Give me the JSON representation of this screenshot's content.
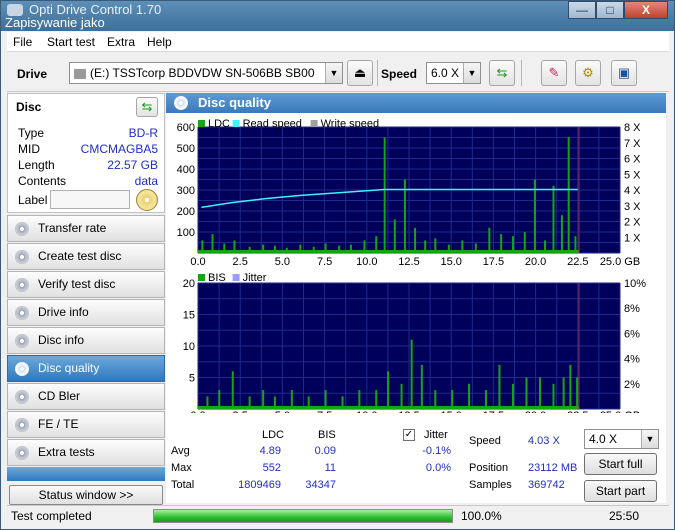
{
  "window": {
    "title": "Opti Drive Control 1.70",
    "subtitle": "Zapisywanie jako",
    "buttons": {
      "minimize": "—",
      "maximize": "□",
      "close": "X"
    }
  },
  "menu": [
    "File",
    "Start test",
    "Extra",
    "Help"
  ],
  "toolbar": {
    "drive_label": "Drive",
    "drive_value": "(E:)  TSSTcorp BDDVDW SN-506BB SB00",
    "speed_label": "Speed",
    "speed_value": "6.0 X"
  },
  "disc": {
    "header": "Disc",
    "fields": [
      {
        "key": "Type",
        "value": "BD-R"
      },
      {
        "key": "MID",
        "value": "CMCMAGBA5"
      },
      {
        "key": "Length",
        "value": "22.57 GB"
      },
      {
        "key": "Contents",
        "value": "data"
      }
    ],
    "label_key": "Label"
  },
  "nav": [
    {
      "label": "Transfer rate",
      "active": false
    },
    {
      "label": "Create test disc",
      "active": false
    },
    {
      "label": "Verify test disc",
      "active": false
    },
    {
      "label": "Drive info",
      "active": false
    },
    {
      "label": "Disc info",
      "active": false
    },
    {
      "label": "Disc quality",
      "active": true
    },
    {
      "label": "CD Bler",
      "active": false
    },
    {
      "label": "FE / TE",
      "active": false
    },
    {
      "label": "Extra tests",
      "active": false
    }
  ],
  "status_window_button": "Status window >>",
  "panel_title": "Disc quality",
  "chart_data": [
    {
      "type": "bar",
      "legend": [
        "LDC",
        "Read speed",
        "Write speed"
      ],
      "legend_colors": [
        "#14a514",
        "#3ff2ff",
        "#a0a0a0"
      ],
      "x_ticks": [
        "0.0",
        "2.5",
        "5.0",
        "7.5",
        "10.0",
        "12.5",
        "15.0",
        "17.5",
        "20.0",
        "22.5",
        "25.0 GB"
      ],
      "xlim": [
        0,
        25
      ],
      "ylim": [
        0,
        600
      ],
      "y_ticks": [
        "600",
        "500",
        "400",
        "300",
        "200",
        "100"
      ],
      "y2_ticks": [
        "8 X",
        "7 X",
        "6 X",
        "5 X",
        "4 X",
        "3 X",
        "2 X",
        "1 X"
      ],
      "y2lim": [
        0,
        8
      ],
      "series": [
        {
          "name": "LDC",
          "x": [
            0.2,
            0.8,
            1.5,
            2.1,
            3.0,
            3.8,
            4.5,
            5.2,
            6.0,
            6.8,
            7.5,
            8.3,
            9.0,
            9.8,
            10.5,
            11.0,
            11.6,
            12.2,
            12.8,
            13.4,
            14.0,
            14.8,
            15.6,
            16.4,
            17.2,
            17.9,
            18.6,
            19.3,
            19.9,
            20.5,
            21.0,
            21.5,
            21.9,
            22.3
          ],
          "values": [
            60,
            90,
            45,
            60,
            30,
            40,
            35,
            25,
            40,
            30,
            45,
            35,
            40,
            60,
            80,
            550,
            160,
            350,
            120,
            60,
            70,
            40,
            60,
            45,
            120,
            90,
            80,
            100,
            350,
            60,
            320,
            180,
            552,
            80
          ]
        },
        {
          "name": "Read speed",
          "x": [
            0.2,
            2,
            4,
            6,
            8,
            10,
            11,
            12,
            14,
            16,
            18,
            20,
            22.5
          ],
          "values": [
            2.9,
            3.2,
            3.45,
            3.65,
            3.8,
            3.95,
            4.03,
            4.03,
            4.03,
            4.03,
            4.03,
            4.03,
            4.03
          ]
        }
      ]
    },
    {
      "type": "bar",
      "legend": [
        "BIS",
        "Jitter"
      ],
      "legend_colors": [
        "#14a514",
        "#9a9aff"
      ],
      "x_ticks": [
        "0.0",
        "2.5",
        "5.0",
        "7.5",
        "10.0",
        "12.5",
        "15.0",
        "17.5",
        "20.0",
        "22.5",
        "25.0 GB"
      ],
      "xlim": [
        0,
        25
      ],
      "ylim": [
        0,
        20
      ],
      "y_ticks": [
        "20",
        "15",
        "10",
        "5"
      ],
      "y2_ticks": [
        "10%",
        "8%",
        "6%",
        "4%",
        "2%"
      ],
      "y2lim": [
        0,
        10
      ],
      "series": [
        {
          "name": "BIS",
          "x": [
            0.5,
            1.2,
            2.0,
            3.0,
            3.8,
            4.5,
            5.5,
            6.5,
            7.5,
            8.5,
            9.5,
            10.5,
            11.2,
            12.0,
            12.6,
            13.2,
            14.0,
            15.0,
            16.0,
            17.0,
            17.8,
            18.6,
            19.4,
            20.2,
            21.0,
            21.6,
            22.0,
            22.4
          ],
          "values": [
            2,
            3,
            6,
            2,
            3,
            2,
            3,
            2,
            3,
            2,
            3,
            3,
            6,
            4,
            11,
            7,
            3,
            3,
            4,
            3,
            7,
            4,
            5,
            5,
            4,
            5,
            7,
            5
          ]
        }
      ]
    }
  ],
  "stats": {
    "col_ldc": "LDC",
    "col_bis": "BIS",
    "jitter_label": "Jitter",
    "rows": [
      {
        "label": "Avg",
        "ldc": "4.89",
        "bis": "0.09",
        "jitter": "-0.1%"
      },
      {
        "label": "Max",
        "ldc": "552",
        "bis": "11",
        "jitter": "0.0%"
      },
      {
        "label": "Total",
        "ldc": "1809469",
        "bis": "34347",
        "jitter": ""
      }
    ],
    "speed_label": "Speed",
    "speed_value": "4.03 X",
    "position_label": "Position",
    "position_value": "23112 MB",
    "samples_label": "Samples",
    "samples_value": "369742",
    "speed_select": "4.0 X",
    "start_full": "Start full",
    "start_part": "Start part"
  },
  "statusbar": {
    "text": "Test completed",
    "progress_percent": 100,
    "progress_text": "100.0%",
    "time": "25:50"
  }
}
